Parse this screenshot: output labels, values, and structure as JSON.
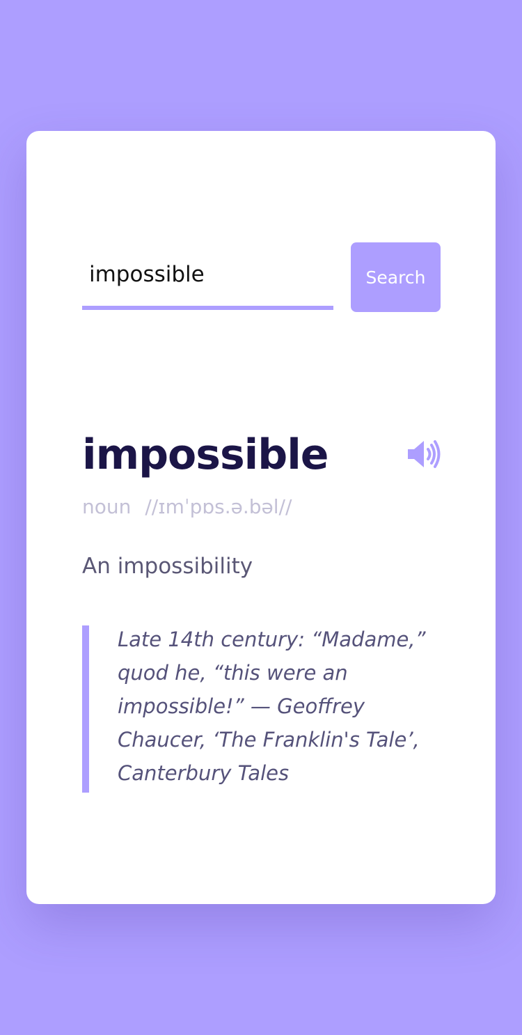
{
  "search": {
    "value": "impossible",
    "button_label": "Search"
  },
  "entry": {
    "word": "impossible",
    "part_of_speech": "noun",
    "phonetic": "//ɪmˈpɒs.ə.bəl//",
    "definition": "An impossibility",
    "example": "Late 14th century: “Madame,” quod he, “this were an impossible!” — Geoffrey Chaucer, ‘The Franklin's Tale’, Canterbury Tales"
  },
  "icons": {
    "audio": "speaker-volume-icon"
  },
  "colors": {
    "background": "#ad9eff",
    "accent": "#ad9eff",
    "title": "#1b1547",
    "muted": "#c3c0d6",
    "body_text": "#5a5775"
  }
}
